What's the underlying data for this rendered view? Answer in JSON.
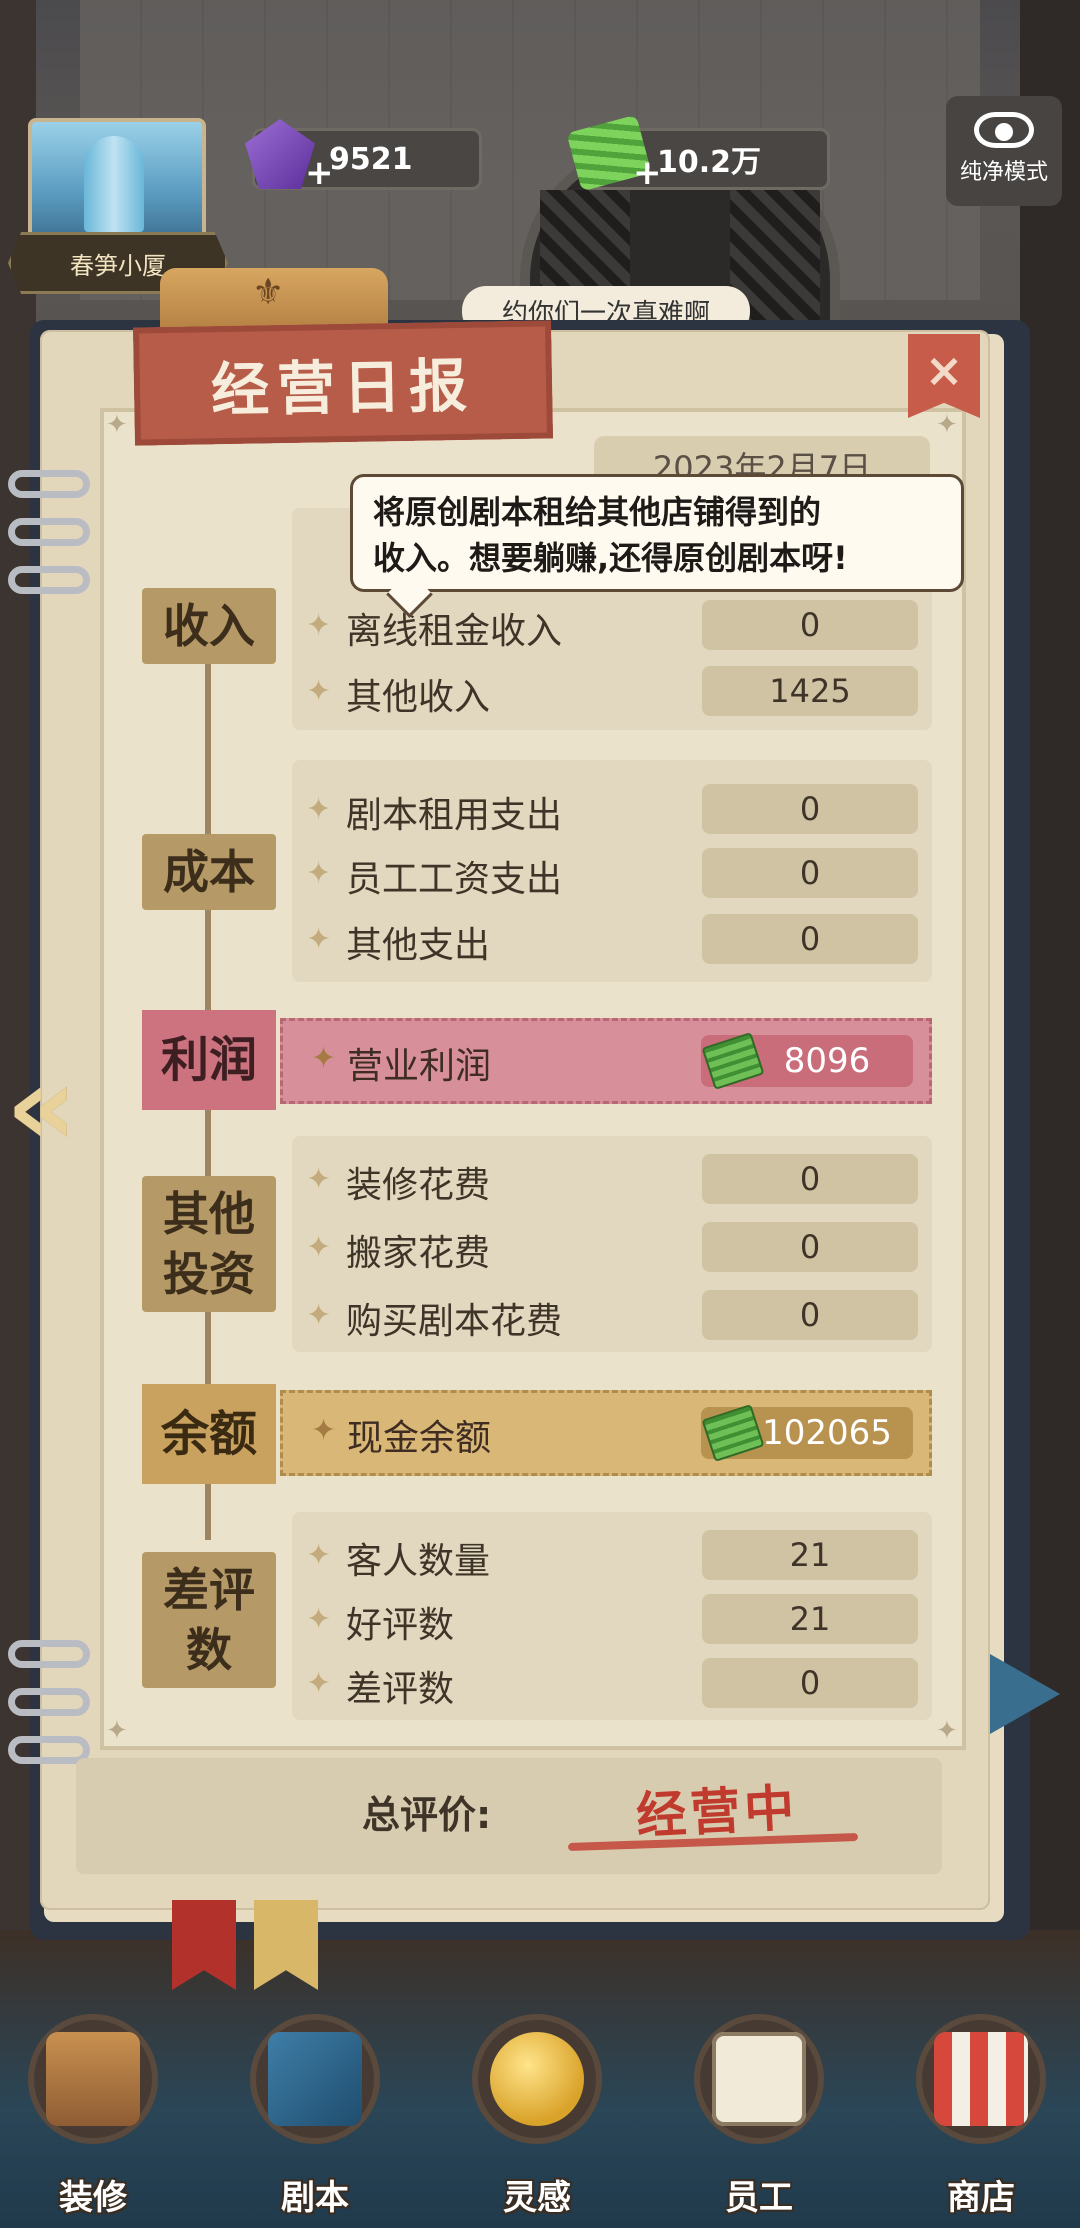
{
  "hud": {
    "building_name": "春笋小厦",
    "gems": "9521",
    "cash": "10.2万",
    "pure_mode": "纯净模式",
    "speech": "约你们一次真难啊"
  },
  "report": {
    "title": "经营日报",
    "date": "2023年2月7日",
    "tooltip_line1": "将原创剧本租给其他店铺得到的",
    "tooltip_line2": "收入。想要躺赚,还得原创剧本呀!",
    "income": {
      "label": "收入",
      "rows": [
        {
          "label": "离线租金收入",
          "value": "0"
        },
        {
          "label": "其他收入",
          "value": "1425"
        }
      ]
    },
    "cost": {
      "label": "成本",
      "rows": [
        {
          "label": "剧本租用支出",
          "value": "0"
        },
        {
          "label": "员工工资支出",
          "value": "0"
        },
        {
          "label": "其他支出",
          "value": "0"
        }
      ]
    },
    "profit": {
      "label": "利润",
      "row_label": "营业利润",
      "value": "8096"
    },
    "investment": {
      "label_line1": "其他",
      "label_line2": "投资",
      "rows": [
        {
          "label": "装修花费",
          "value": "0"
        },
        {
          "label": "搬家花费",
          "value": "0"
        },
        {
          "label": "购买剧本花费",
          "value": "0"
        }
      ]
    },
    "balance": {
      "label": "余额",
      "row_label": "现金余额",
      "value": "102065"
    },
    "reviews": {
      "label_line1": "差评",
      "label_line2": "数",
      "rows": [
        {
          "label": "客人数量",
          "value": "21"
        },
        {
          "label": "好评数",
          "value": "21"
        },
        {
          "label": "差评数",
          "value": "0"
        }
      ]
    },
    "overall_label": "总评价:",
    "overall_status": "经营中"
  },
  "nav": [
    {
      "label": "装修",
      "icon": "house-icon"
    },
    {
      "label": "剧本",
      "icon": "script-book-icon"
    },
    {
      "label": "灵感",
      "icon": "lightbulb-icon"
    },
    {
      "label": "员工",
      "icon": "staff-card-icon"
    },
    {
      "label": "商店",
      "icon": "shop-icon"
    }
  ],
  "colors": {
    "profit": "#d7909a",
    "balance": "#d9b877",
    "close": "#c75c4a",
    "title_ribbon": "#b85c4a"
  }
}
